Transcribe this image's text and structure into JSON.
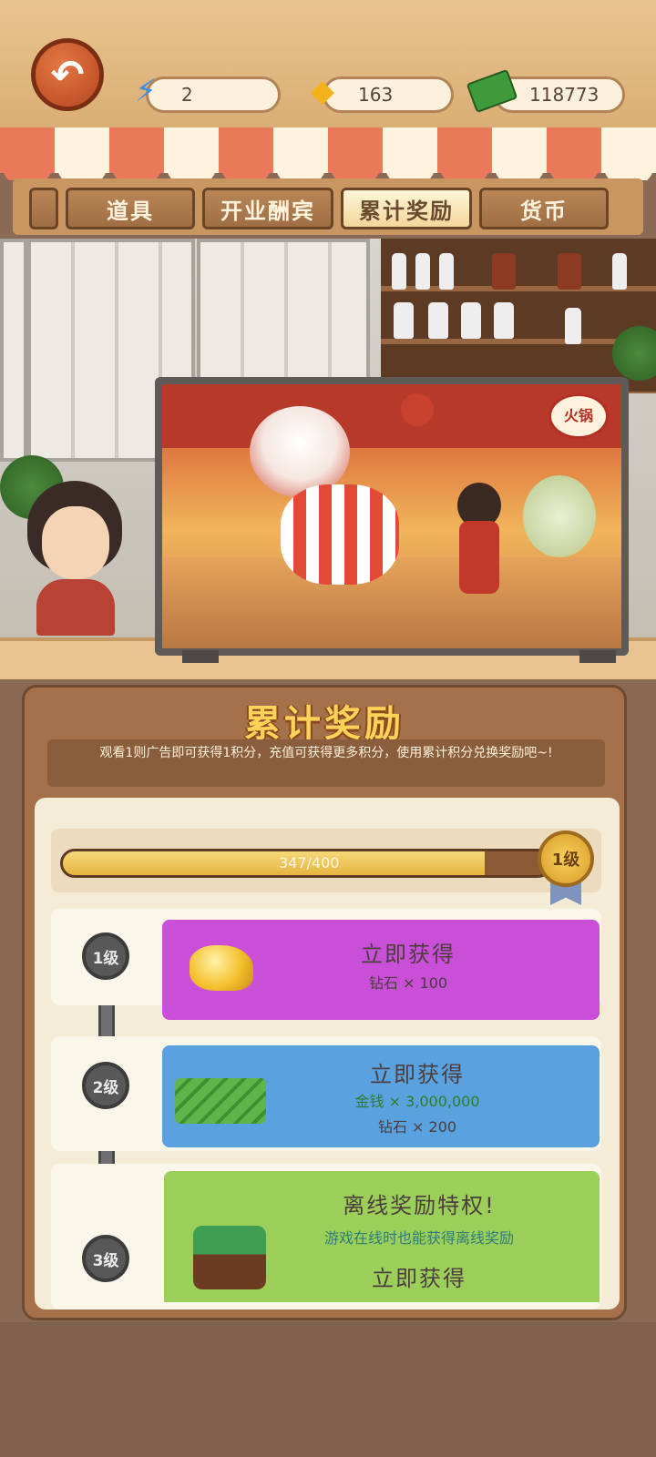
{
  "header": {
    "energy": "2",
    "diamonds": "163",
    "money": "118773"
  },
  "tabs": [
    {
      "label": ""
    },
    {
      "label": "道具"
    },
    {
      "label": "开业酬宾"
    },
    {
      "label": "累计奖励",
      "active": true
    },
    {
      "label": "货币"
    }
  ],
  "tv_sign": "火锅",
  "panel": {
    "title": "累计奖励",
    "description": "观看1则广告即可获得1积分，充值可获得更多积分，使用累计积分兑换奖励吧~!"
  },
  "progress": {
    "label": "347/400",
    "current": 347,
    "max": 400,
    "level": "1级"
  },
  "rewards": [
    {
      "level": "1级",
      "title": "立即获得",
      "lines": [
        "钻石 × 100"
      ],
      "color": "#c94fd8"
    },
    {
      "level": "2级",
      "title": "立即获得",
      "lines": [
        "金钱 × 3,000,000",
        "钻石 × 200"
      ],
      "color": "#5aa1e0"
    },
    {
      "level": "3级",
      "title": "离线奖励特权!",
      "lines": [
        "游戏在线时也能获得离线奖励",
        "立即获得"
      ],
      "color": "#9ccf5a"
    }
  ],
  "colors": {
    "accent_title": "#ffd35a",
    "progress_fill": "#e6b441"
  }
}
